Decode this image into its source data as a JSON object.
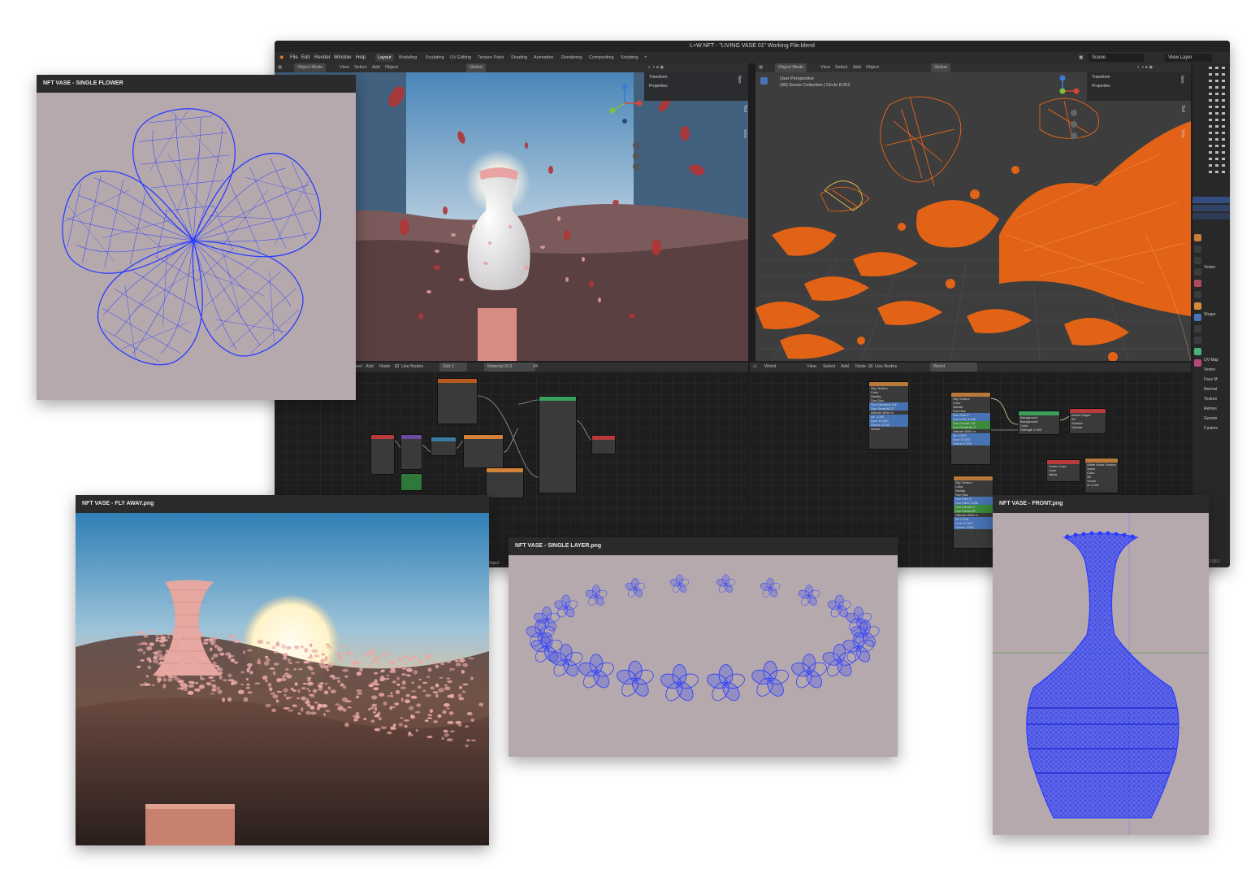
{
  "blender": {
    "title": "L+W NFT - \"LIVING VASE 01\" Working File.blend",
    "menus": [
      "File",
      "Edit",
      "Render",
      "Window",
      "Help"
    ],
    "workspaces": [
      "Layout",
      "Modeling",
      "Sculpting",
      "UV Editing",
      "Texture Paint",
      "Shading",
      "Animation",
      "Rendering",
      "Compositing",
      "Scripting"
    ],
    "active_workspace": "Layout",
    "scene_label": "Scene",
    "view_layer_label": "View Layer",
    "left_viewport": {
      "mode": "Object Mode",
      "header_items": [
        "View",
        "Select",
        "Add",
        "Object"
      ],
      "orientation": "Global",
      "n_panel": [
        "Transform",
        "Properties"
      ],
      "side_tabs": [
        "Item",
        "Tool",
        "View"
      ]
    },
    "right_viewport": {
      "mode": "Object Mode",
      "header_items": [
        "View",
        "Select",
        "Add",
        "Object"
      ],
      "orientation": "Global",
      "overlay_line1": "User Perspective",
      "overlay_line2": "(90) Scene Collection | Circle 8.001",
      "n_panel": [
        "Transform",
        "Properties"
      ],
      "side_tabs": [
        "Item",
        "Tool",
        "View"
      ]
    },
    "left_node_editor": {
      "header_items": [
        "Object",
        "Add",
        "Node"
      ],
      "use_nodes": "Use Nodes",
      "slot": "Slot 1",
      "material": "Material.013",
      "user_count": "34"
    },
    "right_node_editor": {
      "type": "World",
      "header_items": [
        "View",
        "Select",
        "Add",
        "Node"
      ],
      "use_nodes": "Use Nodes",
      "world": "World",
      "nodes": [
        {
          "title": "Sky Texture",
          "rows": [
            "Color",
            "Nishita",
            "Sun Disc",
            "Sun Elevation  0.8°",
            "Sun Rotati  62.4°",
            "Altitude  8000 m",
            "Air  1.000",
            "Dust  10.000",
            "Ozone  4.200",
            "Vector"
          ]
        },
        {
          "title": "Sky Texture",
          "rows": [
            "Color",
            "Nishita",
            "Sun Disc",
            "Sun Size  3°",
            "Sun Inten  3.200",
            "Sun Elevati  3.8°",
            "Sun Rotati  62.4°",
            "Altitude  8000 m",
            "Air  1.000",
            "Dust  10.000",
            "Ozone  4.200"
          ]
        },
        {
          "title": "Background",
          "rows": [
            "Background",
            "Color",
            "Strength  1.000"
          ]
        },
        {
          "title": "World Output",
          "rows": [
            "All",
            "Surface",
            "Volume"
          ]
        },
        {
          "title": "Vertex Color",
          "rows": [
            "Color",
            "Alpha"
          ]
        },
        {
          "title": "White Noise Texture",
          "rows": [
            "Value",
            "Color",
            "3D",
            "Vector",
            "W  0.000"
          ]
        },
        {
          "title": "Sky Texture",
          "rows": [
            "Color",
            "Nishita",
            "Sun Disc",
            "Sun Size  3°",
            "Sun Inten  3.200",
            "Sun Elevati  4°",
            "Sun Rotati  83°",
            "Altitude  8000 m",
            "Air  2.000",
            "Dust  10.000",
            "Ozone  4.500"
          ]
        }
      ]
    },
    "properties_items": [
      "Vertex",
      "Shape",
      "UV Map",
      "Vertex",
      "Face M",
      "Normal",
      "Texture",
      "Remes",
      "Geome",
      "Custom"
    ],
    "version": "2.93.1",
    "status_left": "Object"
  },
  "windows": {
    "single_flower": {
      "title": "NFT VASE - SINGLE FLOWER"
    },
    "fly_away": {
      "title": "NFT VASE - FLY AWAY.png"
    },
    "single_layer": {
      "title": "NFT VASE - SINGLE LAYER.png"
    },
    "front": {
      "title": "NFT VASE - FRONT.png"
    }
  },
  "colors": {
    "wire_blue": "#2a3cff",
    "wire_orange": "#ff6a10",
    "wire_bg": "#b6a9ae",
    "blender_bg": "#1d1d1d",
    "node_grid": "#1e1e1e"
  }
}
